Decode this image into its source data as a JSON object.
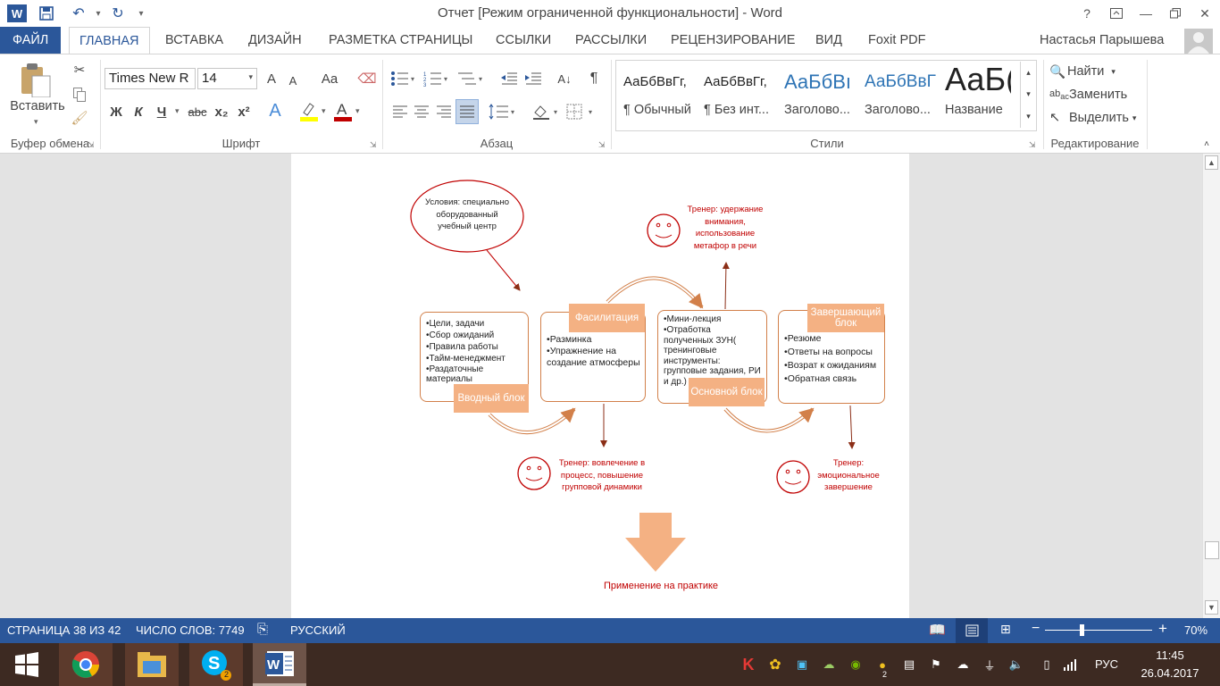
{
  "titlebar": {
    "title": "Отчет [Режим ограниченной функциональности] - Word",
    "help": "?",
    "minimize": "—",
    "close": "✕"
  },
  "tabs": {
    "file": "ФАЙЛ",
    "items": [
      "ГЛАВНАЯ",
      "ВСТАВКА",
      "ДИЗАЙН",
      "РАЗМЕТКА СТРАНИЦЫ",
      "ССЫЛКИ",
      "РАССЫЛКИ",
      "РЕЦЕНЗИРОВАНИЕ",
      "ВИД",
      "Foxit PDF"
    ],
    "active": "ГЛАВНАЯ",
    "user": "Настасья Парышева"
  },
  "ribbon": {
    "clipboard": {
      "paste": "Вставить",
      "group": "Буфер обмена"
    },
    "font": {
      "name": "Times New R",
      "size": "14",
      "group": "Шрифт",
      "bold": "Ж",
      "italic": "К",
      "underline": "Ч",
      "strike": "abc",
      "sub": "x₂",
      "sup": "x²",
      "grow": "A",
      "shrink": "A",
      "case": "Aa"
    },
    "paragraph": {
      "group": "Абзац"
    },
    "styles": {
      "group": "Стили",
      "items": [
        {
          "preview": "АаБбВвГг,",
          "name": "¶ Обычный"
        },
        {
          "preview": "АаБбВвГг,",
          "name": "¶ Без инт..."
        },
        {
          "preview": "АаБбВı",
          "name": "Заголово..."
        },
        {
          "preview": "АаБбВвГ",
          "name": "Заголово..."
        },
        {
          "preview": "АаБ(",
          "name": "Название"
        }
      ]
    },
    "editing": {
      "group": "Редактирование",
      "find": "Найти",
      "replace": "Заменить",
      "select": "Выделить"
    }
  },
  "diagram": {
    "conditions": "Условия: специально оборудованный учебный центр",
    "intro_label": "Вводный блок",
    "intro_items": [
      "Цели, задачи",
      "Сбор ожиданий",
      "Правила работы",
      "Тайм-менеджмент",
      "Раздаточные материалы"
    ],
    "facilitation_label": "Фасилитация",
    "facilitation_items": [
      "Разминка",
      "Упражнение на создание атмосферы"
    ],
    "main_label": "Основной блок",
    "main_items": [
      "Мини-лекция",
      "Отработка полученных ЗУН( тренинговые инструменты: групповые задания, РИ и др.)"
    ],
    "final_label": "Завершающий блок",
    "final_items": [
      "Резюме",
      "Ответы на вопросы",
      "Возрат к ожиданиям",
      "Обратная связь"
    ],
    "trainer1": "Тренер: вовлечение в процесс, повышение групповой динамики",
    "trainer2": "Тренер: удержание внимания, использование метафор в речи",
    "trainer3": "Тренер: эмоциональное завершение",
    "practice": "Применение на практике",
    "colors": {
      "accent": "#f4b183",
      "red": "#c00000",
      "outline": "#d2804a"
    }
  },
  "status": {
    "page": "СТРАНИЦА 38 ИЗ 42",
    "words": "ЧИСЛО СЛОВ: 7749",
    "lang": "РУССКИЙ",
    "zoom": "70%",
    "zoom_percent": 70
  },
  "taskbar": {
    "lang": "РУС",
    "time": "11:45",
    "date": "26.04.2017",
    "skype_badge": "2",
    "tray_badge": "2"
  }
}
